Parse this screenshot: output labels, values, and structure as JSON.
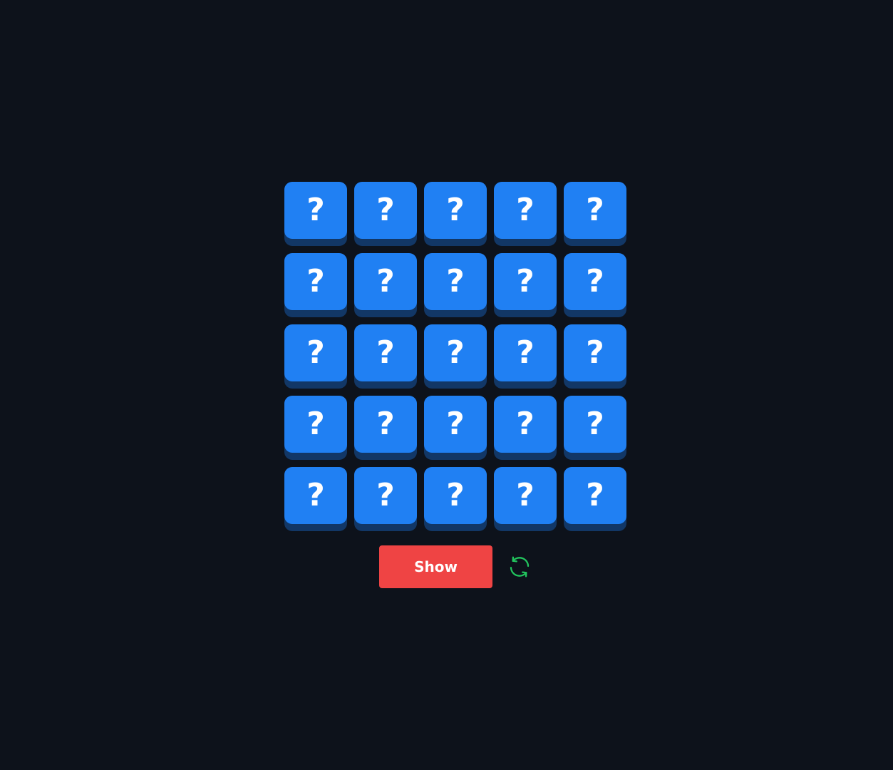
{
  "board": {
    "rows": 5,
    "columns": 5,
    "tile_glyph": "?",
    "tiles": [
      [
        "?",
        "?",
        "?",
        "?",
        "?"
      ],
      [
        "?",
        "?",
        "?",
        "?",
        "?"
      ],
      [
        "?",
        "?",
        "?",
        "?",
        "?"
      ],
      [
        "?",
        "?",
        "?",
        "?",
        "?"
      ],
      [
        "?",
        "?",
        "?",
        "?",
        "?"
      ]
    ]
  },
  "controls": {
    "show_label": "Show",
    "reset_icon": "refresh-icon"
  },
  "colors": {
    "background": "#0d121b",
    "tile_face": "#2080f3",
    "tile_shadow": "#123766",
    "show_button": "#ef4444",
    "reset_icon": "#22c55e"
  }
}
